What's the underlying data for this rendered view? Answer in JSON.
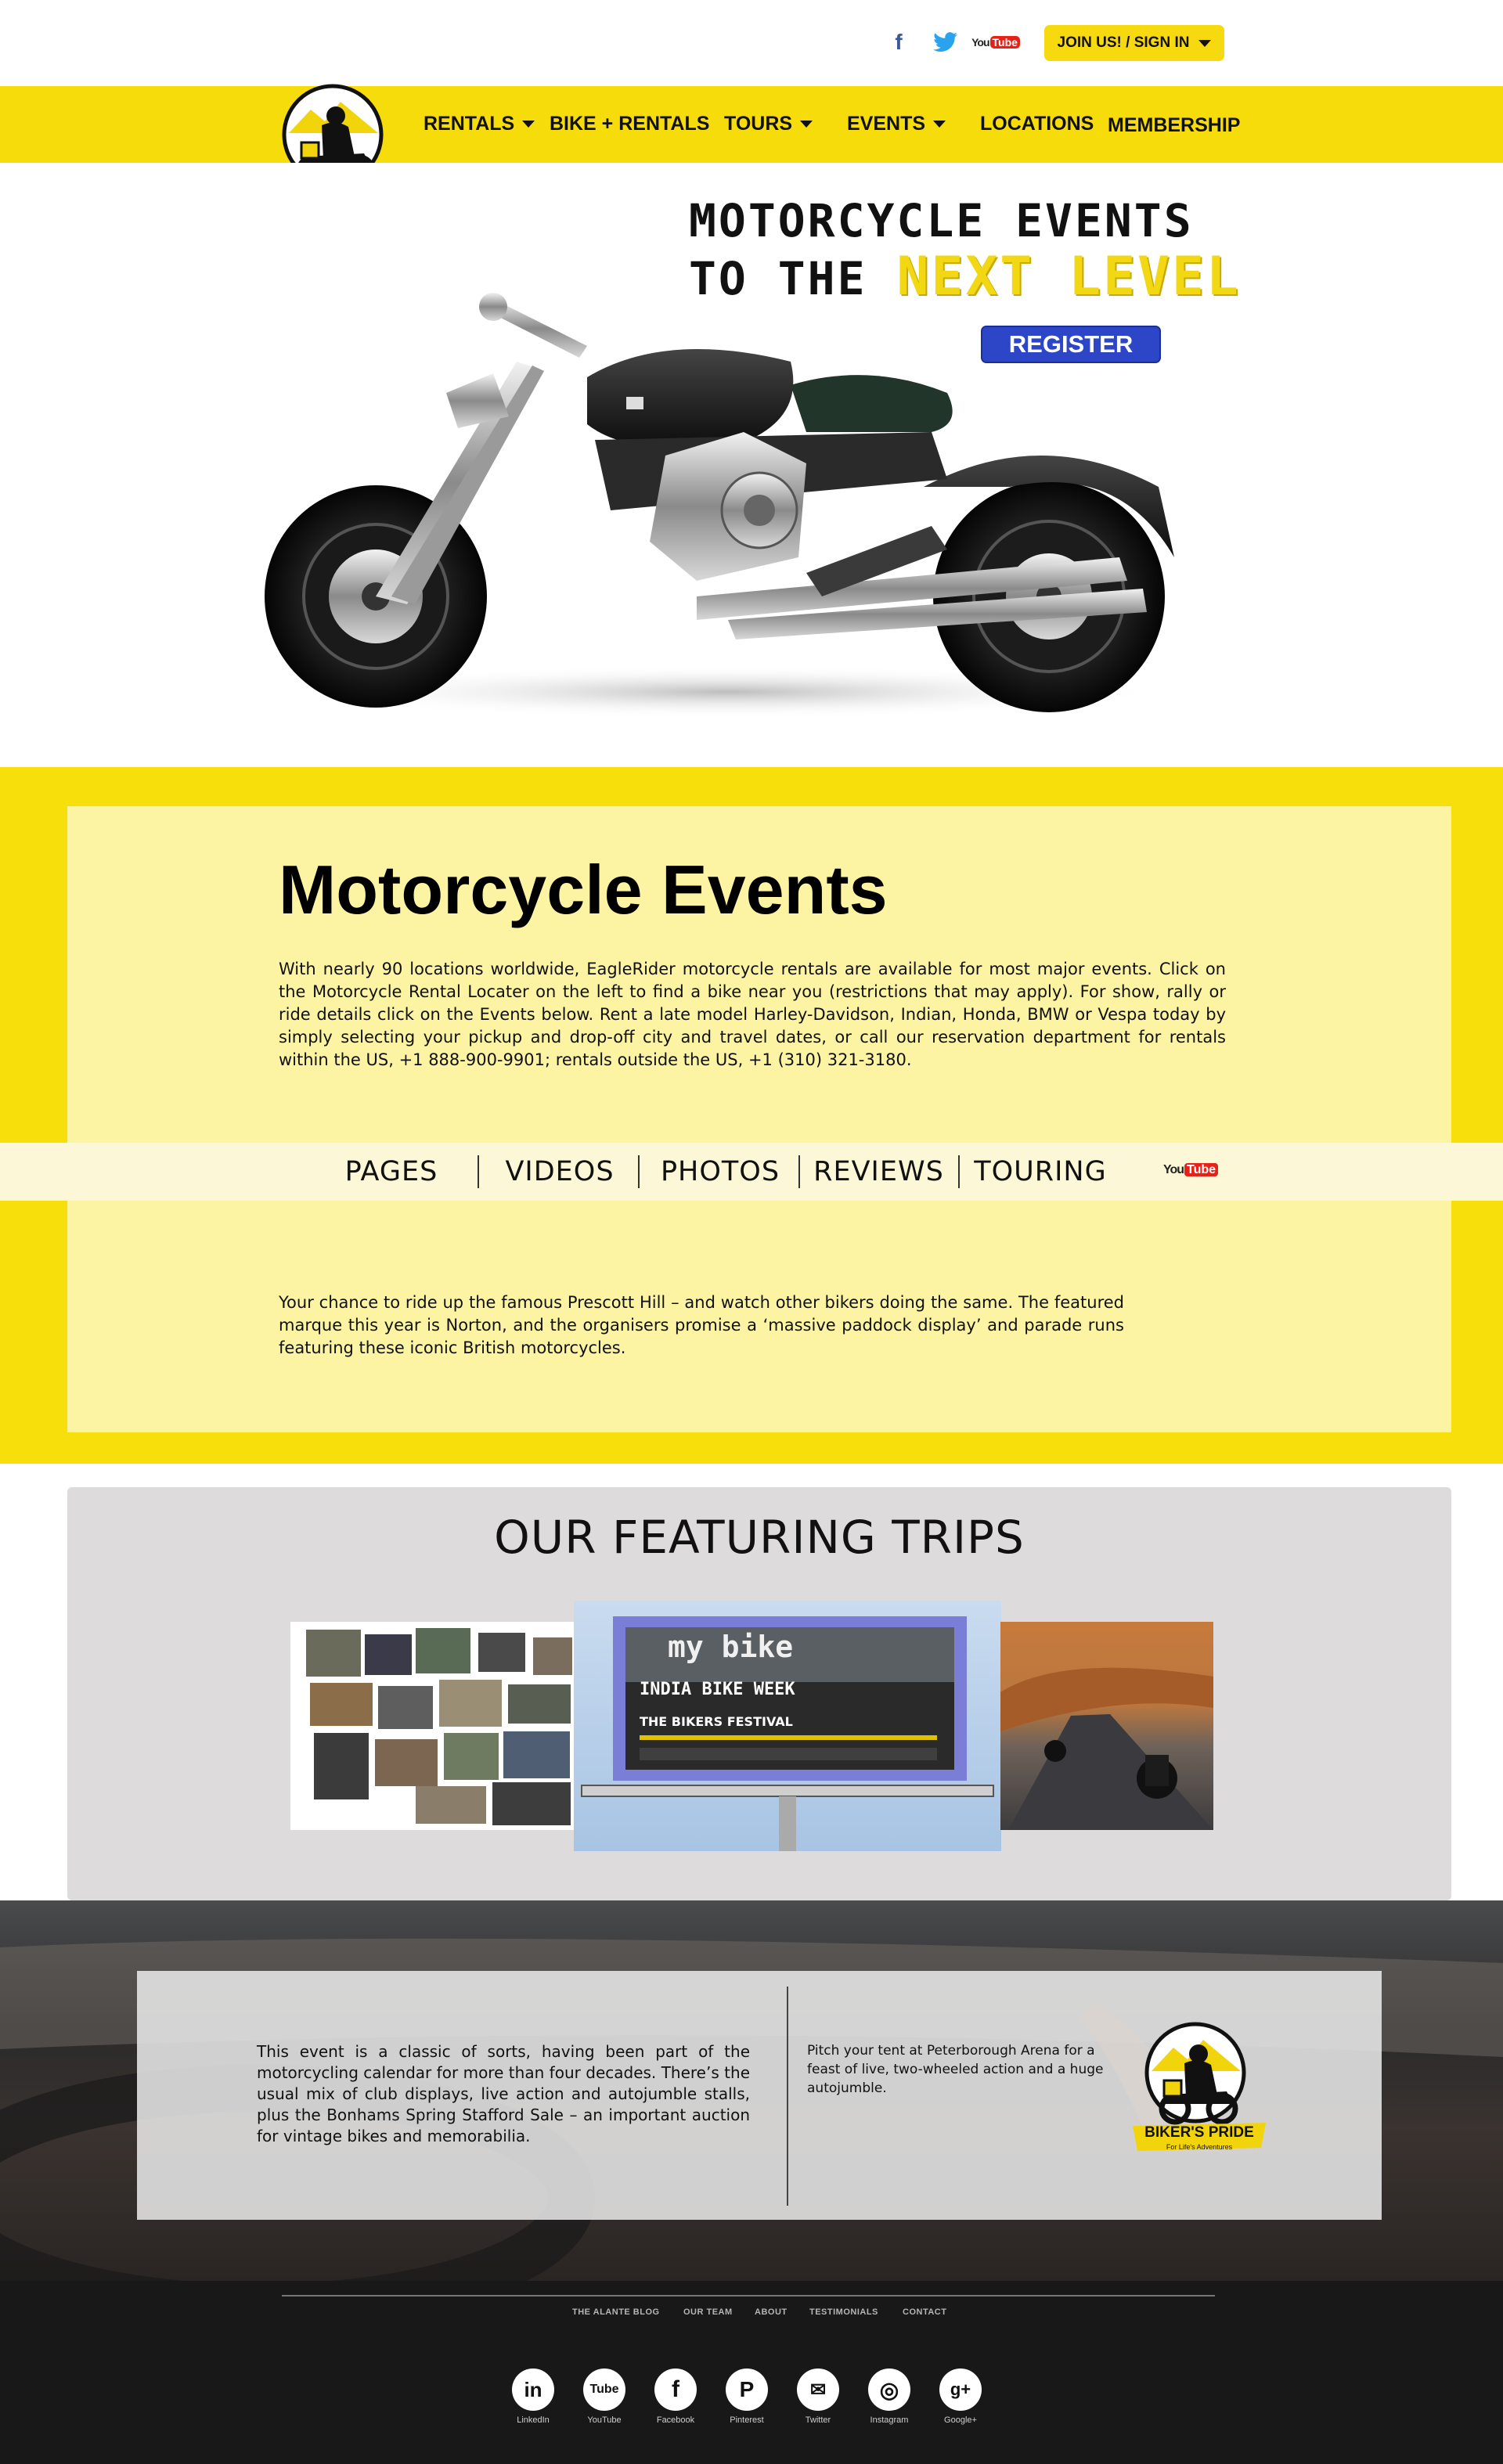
{
  "header": {
    "social_icons": [
      "facebook-icon",
      "twitter-icon",
      "youtube-icon"
    ],
    "youtube_word_a": "You",
    "youtube_word_b": "Tube",
    "join_label": "JOIN US! / SIGN IN"
  },
  "nav": {
    "items": [
      {
        "label": "RENTALS",
        "dropdown": true
      },
      {
        "label": "BIKE + RENTALS",
        "dropdown": false
      },
      {
        "label": "TOURS",
        "dropdown": true
      },
      {
        "label": "EVENTS",
        "dropdown": true
      },
      {
        "label": "LOCATIONS",
        "dropdown": false
      },
      {
        "label": "MEMBERSHIP",
        "dropdown": false
      }
    ]
  },
  "logo": {
    "name": "BIKER'S PRIDE",
    "tagline": "For Life's Adventures"
  },
  "hero": {
    "line1": "MOTORCYCLE EVENTS",
    "line2_prefix": "TO THE ",
    "line2_highlight": "NEXT LEVEL",
    "register_label": "REGISTER"
  },
  "events": {
    "title": "Motorcycle Events",
    "paragraph": "With nearly 90 locations worldwide, EagleRider motorcycle rentals are available for most major events. Click on the Motorcycle Rental Locater on the left to find a bike near you (restrictions that may apply). For show, rally or ride details click on the Events below. Rent a late model Harley-Davidson, Indian, Honda, BMW or Vespa today by simply selecting your pickup and drop-off city and travel dates, or call our reservation department for rentals within the US, +1 888-900-9901; rentals outside the US, +1 (310) 321-3180.",
    "tabs": [
      "PAGES",
      "VIDEOS",
      "PHOTOS",
      "REVIEWS",
      "TOURING"
    ],
    "tab_youtube_a": "You",
    "tab_youtube_b": "Tube",
    "prescott_paragraph": "Your chance to ride up the famous Prescott Hill – and watch other bikers doing the same. The featured marque this year is Norton, and the organisers promise a ‘massive paddock display’ and parade runs featuring these iconic British motorcycles."
  },
  "trips": {
    "title": "OUR FEATURING TRIPS",
    "billboard_title": "my bike",
    "billboard_sub": "INDIA BIKE WEEK",
    "billboard_festival": "THE BIKERS FESTIVAL"
  },
  "footer_card": {
    "classic_paragraph": "This event is a classic of sorts, having been part of the motorcycling calendar for more than four decades. There’s the usual mix of club displays, live action and autojumble stalls, plus the Bonhams Spring Stafford Sale – an important auction for vintage bikes and memorabilia.",
    "pitch_paragraph": "Pitch your tent at Peterborough Arena for a feast of live, two-wheeled action and a huge autojumble."
  },
  "footer": {
    "links": [
      "THE ALANTE BLOG",
      "OUR TEAM",
      "ABOUT",
      "TESTIMONIALS",
      "CONTACT"
    ],
    "social": [
      {
        "label": "LinkedIn",
        "glyph": "in",
        "icon": "linkedin-icon"
      },
      {
        "label": "YouTube",
        "glyph": "Tube",
        "icon": "youtube-icon"
      },
      {
        "label": "Facebook",
        "glyph": "f",
        "icon": "facebook-icon"
      },
      {
        "label": "Pinterest",
        "glyph": "P",
        "icon": "pinterest-icon"
      },
      {
        "label": "Twitter",
        "glyph": "✉",
        "icon": "twitter-icon"
      },
      {
        "label": "Instagram",
        "glyph": "◎",
        "icon": "instagram-icon"
      },
      {
        "label": "Google+",
        "glyph": "g+",
        "icon": "google-plus-icon"
      }
    ]
  },
  "colors": {
    "brand_yellow": "#f7dc0c",
    "card_yellow": "#fcf4a3",
    "register_blue": "#2d46c7",
    "footer_dark": "#181818"
  }
}
